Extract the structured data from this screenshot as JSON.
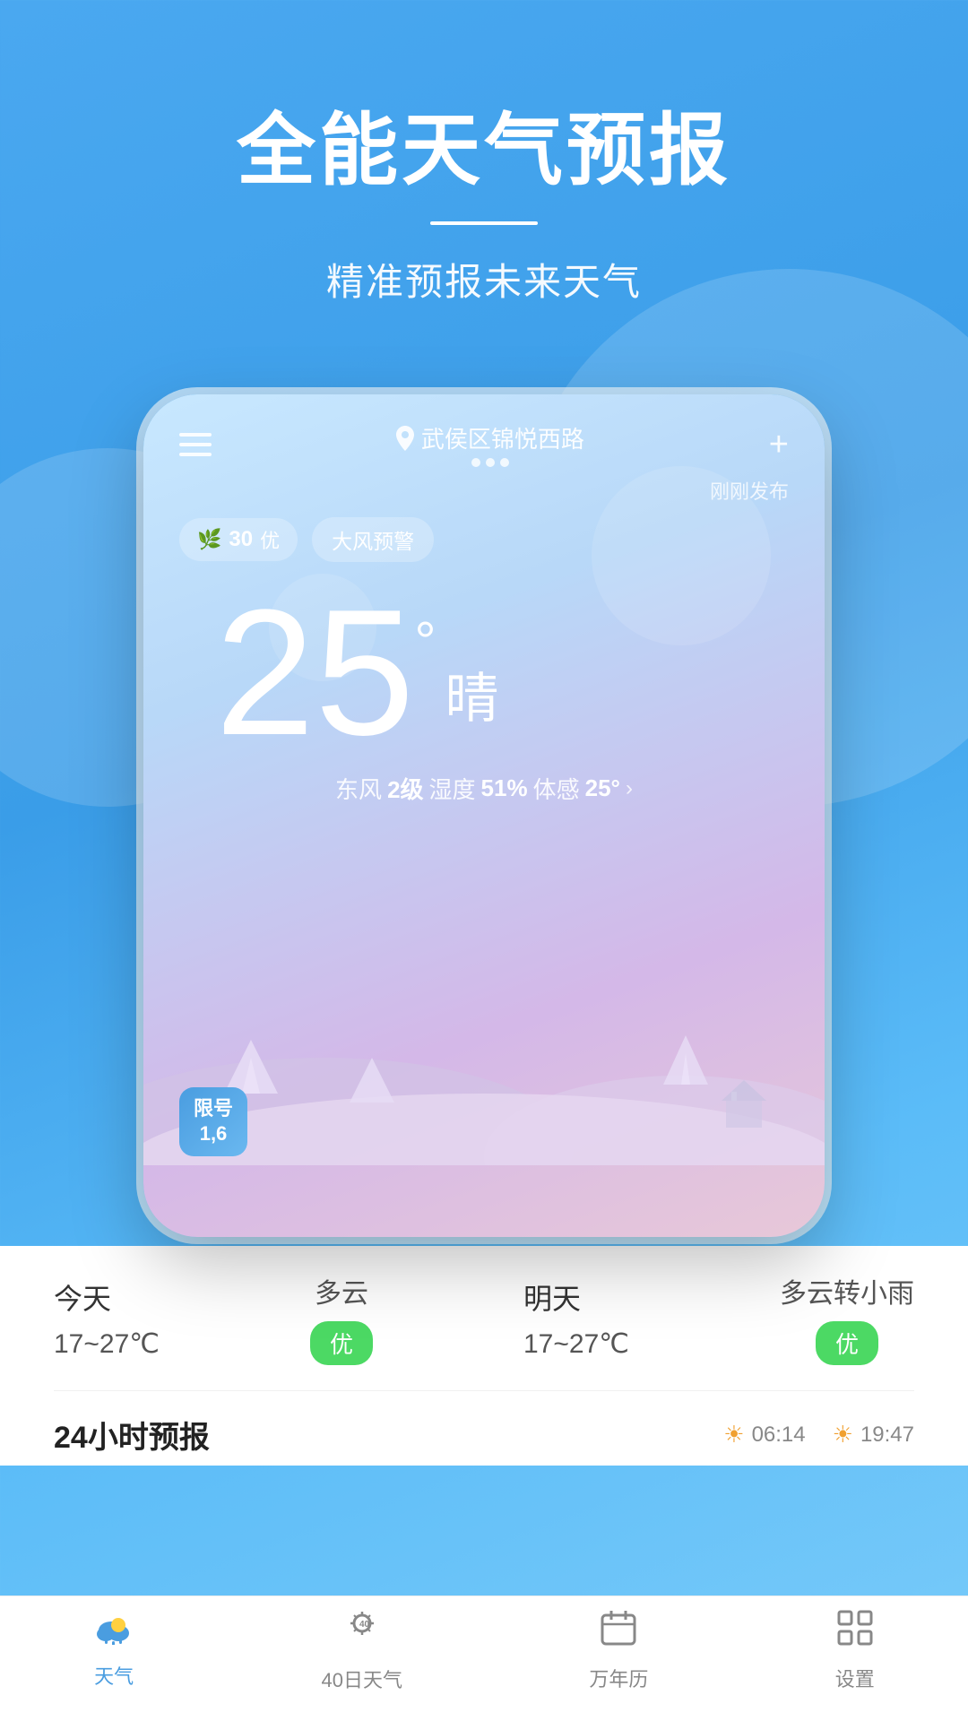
{
  "app": {
    "title": "全能天气预报",
    "divider": "—",
    "subtitle": "精准预报未来天气"
  },
  "phone": {
    "location": "武侯区锦悦西路",
    "publish_time": "刚刚发布",
    "aqi": {
      "value": "30",
      "quality": "优"
    },
    "alert": "大风预警",
    "temperature": "25",
    "degree_symbol": "°",
    "condition": "晴",
    "wind": "东风",
    "wind_level": "2级",
    "humidity_label": "湿度",
    "humidity": "51%",
    "feel_label": "体感",
    "feel_temp": "25°",
    "license": {
      "line1": "限号",
      "line2": "1,6"
    }
  },
  "forecast": {
    "today": {
      "day": "今天",
      "condition": "多云",
      "temp": "17~27℃",
      "quality": "优"
    },
    "tomorrow": {
      "day": "明天",
      "condition": "多云转小雨",
      "temp": "17~27℃",
      "quality": "优"
    }
  },
  "hourly": {
    "title": "24小时预报",
    "sunrise": "06:14",
    "sunset": "19:47"
  },
  "nav": {
    "items": [
      {
        "label": "天气",
        "active": true
      },
      {
        "label": "40日天气",
        "active": false
      },
      {
        "label": "万年历",
        "active": false
      },
      {
        "label": "设置",
        "active": false
      }
    ]
  }
}
